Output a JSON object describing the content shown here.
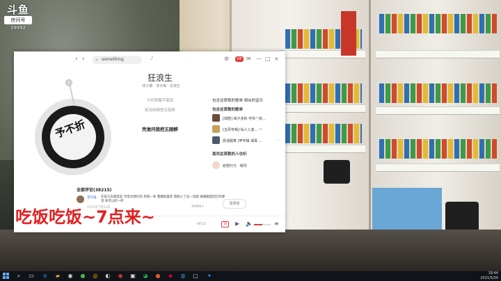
{
  "watermark": {
    "logo": "斗鱼",
    "badge": "房间号",
    "room_id": "39992"
  },
  "player": {
    "nav": {
      "back": "‹",
      "forward": "›"
    },
    "search": {
      "placeholder": "something"
    },
    "vip_badge": "VIP",
    "song": {
      "title": "狂浪生",
      "meta": "· 祥小霸 · 李示梅 · 狂浪生"
    },
    "disc_art": "予不折",
    "lyrics": [
      {
        "text": "为何梦醒不需哀",
        "active": false
      },
      {
        "text": "笑骂闲情把五陵醉",
        "active": false
      },
      {
        "text": "凭谁问我把五陵醉",
        "active": true
      }
    ],
    "sidebar": {
      "heading": "包含这首歌的歌单  相似的音乐",
      "playlists_title": "包含这首歌的歌单",
      "playlists": [
        {
          "text": "[戏腔] 戏子多秋 可怜一处...",
          "color": "#6b4b3a"
        },
        {
          "text": "[古风专辑] 仙人入蓝... 一",
          "color": "#c7a15a"
        },
        {
          "text": "民谣甜章 [甲专辑 戒毒 ...",
          "color": "#4a5a6a"
        }
      ],
      "users_title": "喜欢这首歌的人也听",
      "user": {
        "name": "甜橙时光 · 暖阳"
      }
    },
    "comments": {
      "title": "全部评论(38215)",
      "user": "李华强",
      "text": "在前几天那是些 可惜为我们的 到第一条 我都很喜欢 而刚入了这一首歌 满满都是回忆的感觉 你可以听一听",
      "time": "2021年7月13日",
      "likes": "10000+",
      "write_button": "写评论"
    },
    "bottom": {
      "time": "00:12",
      "badge": "词",
      "play_icon": "▶",
      "volume_icon": "🔈",
      "list_icon": "≡"
    }
  },
  "caption": "吃饭吃饭~7点来~",
  "taskbar": {
    "clock_time": "18:44",
    "clock_date": "2021/5/30"
  }
}
